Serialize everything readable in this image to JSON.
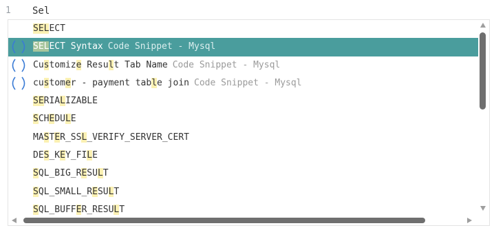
{
  "editor": {
    "line_number": "1",
    "line_text": "Sel"
  },
  "suggestions": [
    {
      "icon": "none",
      "selected": false,
      "segments": [
        {
          "t": "SEL",
          "h": true
        },
        {
          "t": "ECT",
          "h": false
        }
      ],
      "desc": ""
    },
    {
      "icon": "snippet-brackets-icon",
      "selected": true,
      "segments": [
        {
          "t": "SEL",
          "h": true
        },
        {
          "t": "ECT Syntax",
          "h": false
        }
      ],
      "desc": "Code Snippet - Mysql"
    },
    {
      "icon": "snippet-brackets-icon",
      "selected": false,
      "segments": [
        {
          "t": "Cu",
          "h": false
        },
        {
          "t": "s",
          "h": true
        },
        {
          "t": "tomiz",
          "h": false
        },
        {
          "t": "e",
          "h": true
        },
        {
          "t": " Resu",
          "h": false
        },
        {
          "t": "l",
          "h": true
        },
        {
          "t": "t Tab Name",
          "h": false
        }
      ],
      "desc": "Code Snippet - Mysql"
    },
    {
      "icon": "snippet-brackets-icon",
      "selected": false,
      "segments": [
        {
          "t": "cu",
          "h": false
        },
        {
          "t": "s",
          "h": true
        },
        {
          "t": "tom",
          "h": false
        },
        {
          "t": "e",
          "h": true
        },
        {
          "t": "r - payment tab",
          "h": false
        },
        {
          "t": "l",
          "h": true
        },
        {
          "t": "e join",
          "h": false
        }
      ],
      "desc": "Code Snippet - Mysql"
    },
    {
      "icon": "none",
      "selected": false,
      "segments": [
        {
          "t": "S",
          "h": true
        },
        {
          "t": "E",
          "h": true
        },
        {
          "t": "RIA",
          "h": false
        },
        {
          "t": "L",
          "h": true
        },
        {
          "t": "IZABLE",
          "h": false
        }
      ],
      "desc": ""
    },
    {
      "icon": "none",
      "selected": false,
      "segments": [
        {
          "t": "S",
          "h": true
        },
        {
          "t": "CH",
          "h": false
        },
        {
          "t": "E",
          "h": true
        },
        {
          "t": "DU",
          "h": false
        },
        {
          "t": "L",
          "h": true
        },
        {
          "t": "E",
          "h": false
        }
      ],
      "desc": ""
    },
    {
      "icon": "none",
      "selected": false,
      "segments": [
        {
          "t": "MA",
          "h": false
        },
        {
          "t": "S",
          "h": true
        },
        {
          "t": "T",
          "h": false
        },
        {
          "t": "E",
          "h": true
        },
        {
          "t": "R_SS",
          "h": false
        },
        {
          "t": "L",
          "h": true
        },
        {
          "t": "_VERIFY_SERVER_CERT",
          "h": false
        }
      ],
      "desc": ""
    },
    {
      "icon": "none",
      "selected": false,
      "segments": [
        {
          "t": "DE",
          "h": false
        },
        {
          "t": "S",
          "h": true
        },
        {
          "t": "_K",
          "h": false
        },
        {
          "t": "E",
          "h": true
        },
        {
          "t": "Y_FI",
          "h": false
        },
        {
          "t": "L",
          "h": true
        },
        {
          "t": "E",
          "h": false
        }
      ],
      "desc": ""
    },
    {
      "icon": "none",
      "selected": false,
      "segments": [
        {
          "t": "S",
          "h": true
        },
        {
          "t": "QL_BIG_R",
          "h": false
        },
        {
          "t": "E",
          "h": true
        },
        {
          "t": "SU",
          "h": false
        },
        {
          "t": "L",
          "h": true
        },
        {
          "t": "T",
          "h": false
        }
      ],
      "desc": ""
    },
    {
      "icon": "none",
      "selected": false,
      "segments": [
        {
          "t": "S",
          "h": true
        },
        {
          "t": "QL_SMALL_R",
          "h": false
        },
        {
          "t": "E",
          "h": true
        },
        {
          "t": "SU",
          "h": false
        },
        {
          "t": "L",
          "h": true
        },
        {
          "t": "T",
          "h": false
        }
      ],
      "desc": ""
    },
    {
      "icon": "none",
      "selected": false,
      "segments": [
        {
          "t": "S",
          "h": true
        },
        {
          "t": "QL_BUFF",
          "h": false
        },
        {
          "t": "E",
          "h": true
        },
        {
          "t": "R_RESU",
          "h": false
        },
        {
          "t": "L",
          "h": true
        },
        {
          "t": "T",
          "h": false
        }
      ],
      "desc": ""
    }
  ],
  "colors": {
    "selected_bg": "#4a9d9d",
    "match_highlight": "#fbf1b3",
    "snippet_icon": "#3a7bd5"
  }
}
